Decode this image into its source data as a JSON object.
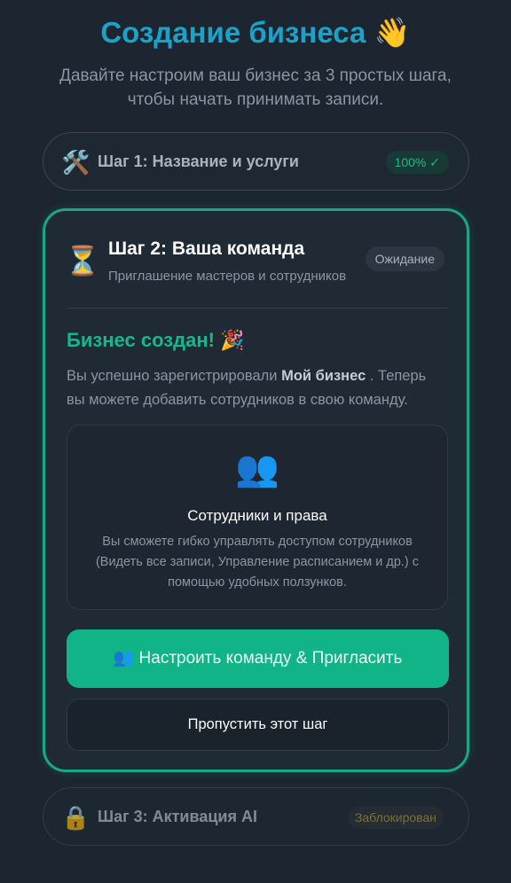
{
  "header": {
    "title": "Создание бизнеса",
    "title_emoji": "👋",
    "subtitle": "Давайте настроим ваш бизнес за 3 простых шага, чтобы начать принимать записи."
  },
  "steps": [
    {
      "icon": "🛠️",
      "icon_name": "tools-icon",
      "label": "Шаг 1: Название и услуги",
      "badge": "100% ✓",
      "status_color": "#1fb88a"
    },
    {
      "icon": "⏳",
      "icon_name": "hourglass-icon",
      "label": "Шаг 2: Ваша команда",
      "description": "Приглашение мастеров и сотрудников",
      "badge": "Ожидание",
      "accent_color": "#17a88a"
    },
    {
      "icon": "🔒",
      "icon_name": "lock-icon",
      "label": "Шаг 3: Активация AI",
      "badge": "Заблокирован",
      "status_color": "#a38a3a"
    }
  ],
  "active_step": {
    "success_title": "Бизнес создан!",
    "success_emoji": "🎉",
    "message_prefix": "Вы успешно зарегистрировали",
    "business_name": "Мой бизнес",
    "message_suffix": ". Теперь вы можете добавить сотрудников в свою команду.",
    "info_box": {
      "icon": "👥",
      "icon_name": "people-icon",
      "title": "Сотрудники и права",
      "text": "Вы сможете гибко управлять доступом сотрудников (Видеть все записи, Управление расписанием и др.) с помощью удобных ползунков."
    },
    "primary_button": "👥 Настроить команду & Пригласить",
    "secondary_button": "Пропустить этот шаг"
  },
  "colors": {
    "background": "#1c2530",
    "title": "#1aa3c9",
    "primary": "#11b487"
  }
}
